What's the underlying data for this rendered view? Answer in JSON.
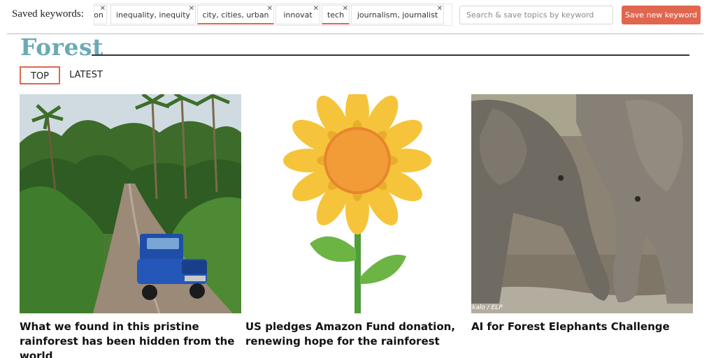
{
  "saved_keywords": {
    "label": "Saved keywords:",
    "chips": [
      {
        "label": "on"
      },
      {
        "label": "inequality, inequity"
      },
      {
        "label": "city, cities, urban"
      },
      {
        "label": "innovat"
      },
      {
        "label": "tech"
      },
      {
        "label": "journalism, journalist"
      }
    ]
  },
  "search": {
    "placeholder": "Search & save topics by keyword"
  },
  "save_button": {
    "label": "Save new keyword"
  },
  "page": {
    "title": "Forest"
  },
  "tabs": [
    {
      "label": "TOP",
      "active": true
    },
    {
      "label": "LATEST",
      "active": false
    }
  ],
  "articles": [
    {
      "title": "What we found in this pristine rainforest has been hidden from the world"
    },
    {
      "title": "US pledges Amazon Fund donation, renewing hope for the rainforest"
    },
    {
      "title": "AI for Forest Elephants Challenge",
      "credit": "kalo / ELP"
    }
  ],
  "colors": {
    "accent": "#e0664f",
    "title": "#6aaab6"
  }
}
